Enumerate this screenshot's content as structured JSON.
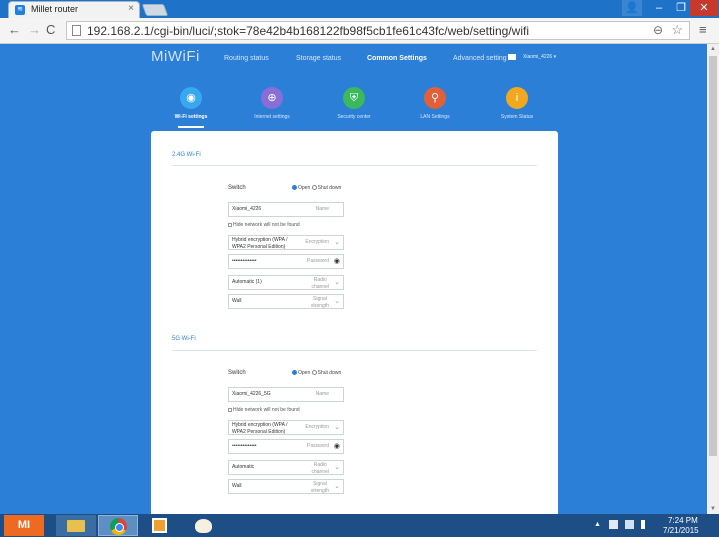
{
  "browser": {
    "tab_title": "Millet router",
    "tab_close": "×",
    "url": "192.168.2.1/cgi-bin/luci/;stok=78e42b4b168122fb98f5cb1fe61c43fc/web/setting/wifi",
    "back": "←",
    "forward": "→",
    "reload": "C",
    "zoom": "⊖",
    "star": "☆",
    "menu": "≡",
    "win_user": "👤",
    "win_min": "–",
    "win_max": "❐",
    "win_close": "✕"
  },
  "header": {
    "logo": "MiWiFi",
    "nav": [
      "Routing status",
      "Storage status",
      "Common Settings",
      "Advanced setting"
    ],
    "account": "Xiaomi_4226 ▾"
  },
  "subnav": [
    {
      "label": "Wi-Fi settings",
      "icon": "wifi-icon",
      "glyph": "◉"
    },
    {
      "label": "Internet settings",
      "icon": "globe-icon",
      "glyph": "⊕"
    },
    {
      "label": "Security center",
      "icon": "shield-icon",
      "glyph": "⛨"
    },
    {
      "label": "LAN Settings",
      "icon": "lan-icon",
      "glyph": "⚲"
    },
    {
      "label": "System Status",
      "icon": "info-icon",
      "glyph": "i"
    }
  ],
  "wifi24": {
    "title": "2.4G Wi-Fi",
    "switch_label": "Switch",
    "open": "Open",
    "shutdown": "Shut down",
    "name_value": "Xiaomi_4226",
    "name_label": "Name",
    "hide_label": "Hide network will not be found",
    "encryption_value_1": "Hybrid encryption (WPA /",
    "encryption_value_2": "WPA2 Personal Edition)",
    "encryption_label": "Encryption",
    "password_value": "••••••••••••••",
    "password_label": "Password",
    "channel_value": "Automatic (1)",
    "channel_label_1": "Radio",
    "channel_label_2": "channel",
    "strength_value": "Wall",
    "strength_label_1": "Signal",
    "strength_label_2": "strength"
  },
  "wifi5": {
    "title": "5G Wi-Fi",
    "switch_label": "Switch",
    "open": "Open",
    "shutdown": "Shut down",
    "name_value": "Xiaomi_4226_5G",
    "name_label": "Name",
    "hide_label": "Hide network will not be found",
    "encryption_value_1": "Hybrid encryption (WPA /",
    "encryption_value_2": "WPA2 Personal Edition)",
    "encryption_label": "Encryption",
    "password_value": "••••••••••••••",
    "password_label": "Password",
    "channel_value": "Automatic",
    "channel_label_1": "Radio",
    "channel_label_2": "channel",
    "strength_value": "Wall",
    "strength_label_1": "Signal",
    "strength_label_2": "strength"
  },
  "taskbar": {
    "mi_label": "MI",
    "tray_arrow": "▲",
    "time": "7:24 PM",
    "date": "7/21/2015"
  },
  "colors": {
    "page_bg": "#2b7fd6",
    "accent": "#2b7fd6"
  }
}
